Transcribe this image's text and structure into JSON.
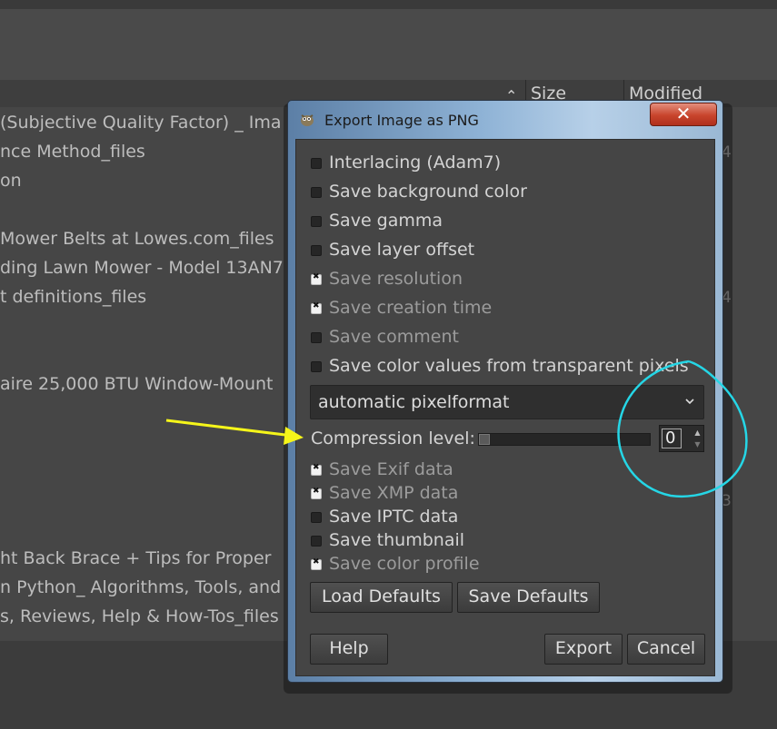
{
  "background": {
    "columns": {
      "size": "Size",
      "modified": "Modified"
    },
    "files": [
      "(Subjective Quality Factor) _ Ima",
      "nce Method_files",
      "on",
      "Mower Belts at Lowes.com_files",
      "ding Lawn Mower - Model 13AN7",
      "t definitions_files",
      "aire 25,000 BTU Window-Mount",
      "ht Back Brace + Tips for Proper",
      "n Python_ Algorithms, Tools, and",
      "s, Reviews, Help & How-Tos_files"
    ],
    "side_numbers": [
      "4",
      "4",
      "3"
    ]
  },
  "dialog": {
    "title": "Export Image as PNG",
    "close_label": "✕",
    "options": [
      {
        "label": "Interlacing (Adam7)",
        "checked": false
      },
      {
        "label": "Save background color",
        "checked": false
      },
      {
        "label": "Save gamma",
        "checked": false
      },
      {
        "label": "Save layer offset",
        "checked": false
      },
      {
        "label": "Save resolution",
        "checked": true
      },
      {
        "label": "Save creation time",
        "checked": true
      },
      {
        "label": "Save comment",
        "checked": false
      },
      {
        "label": "Save color values from transparent pixels",
        "checked": false
      }
    ],
    "pixelformat": "automatic pixelformat",
    "compression_label": "Compression level:",
    "compression_value": "0",
    "metadata": [
      {
        "label": "Save Exif data",
        "checked": true
      },
      {
        "label": "Save XMP data",
        "checked": true
      },
      {
        "label": "Save IPTC data",
        "checked": false
      },
      {
        "label": "Save thumbnail",
        "checked": false
      },
      {
        "label": "Save color profile",
        "checked": true
      }
    ],
    "buttons": {
      "load_defaults": "Load Defaults",
      "save_defaults": "Save Defaults",
      "help": "Help",
      "export": "Export",
      "cancel": "Cancel"
    }
  },
  "colors": {
    "annotation_arrow": "#f5f51a",
    "annotation_circle": "#25d6e6",
    "titlebar": "#8fb3d6",
    "close_button": "#c8442c"
  }
}
